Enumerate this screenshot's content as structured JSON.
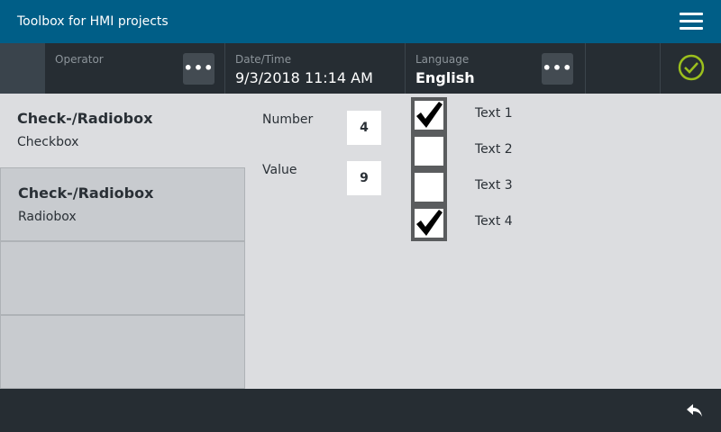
{
  "header": {
    "title": "Toolbox for HMI projects",
    "menu_icon": "hamburger-icon"
  },
  "statusbar": {
    "operator": {
      "label": "Operator",
      "button": "•••"
    },
    "datetime": {
      "label": "Date/Time",
      "value": "9/3/2018 11:14 AM"
    },
    "language": {
      "label": "Language",
      "value": "English",
      "button": "•••"
    },
    "status_icon": "check-circle-icon",
    "status_color": "#9bbf1d"
  },
  "nav": {
    "items": [
      {
        "title": "Check-/Radiobox",
        "subtitle": "Checkbox"
      },
      {
        "title": "Check-/Radiobox",
        "subtitle": "Radiobox"
      }
    ]
  },
  "fields": {
    "number": {
      "label": "Number",
      "value": "4"
    },
    "value": {
      "label": "Value",
      "value": "9"
    }
  },
  "checkboxes": [
    {
      "label": "Text 1",
      "checked": true
    },
    {
      "label": "Text 2",
      "checked": false
    },
    {
      "label": "Text 3",
      "checked": false
    },
    {
      "label": "Text 4",
      "checked": true
    }
  ],
  "footer": {
    "back_icon": "back-arrow-icon"
  }
}
